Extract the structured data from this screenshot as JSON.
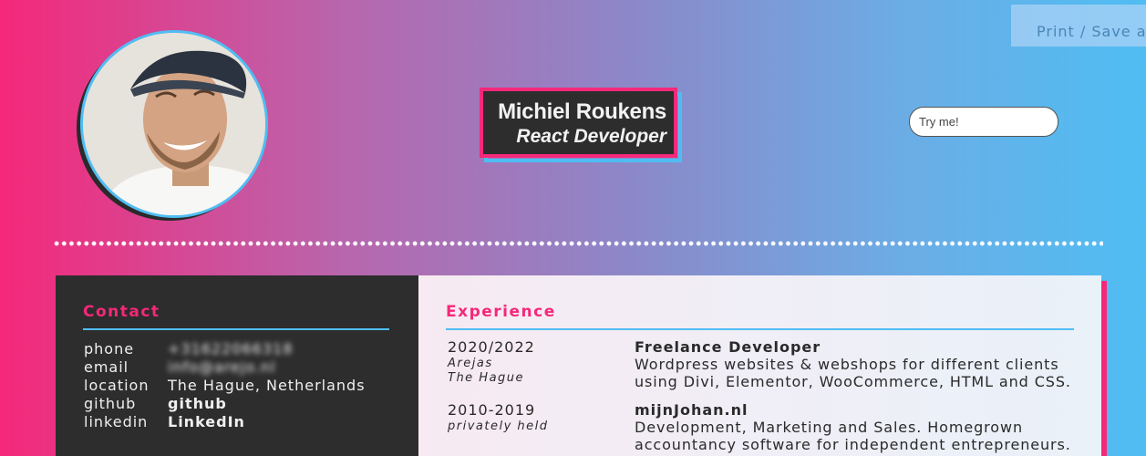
{
  "print_button": {
    "label": "Print / Save as PDF"
  },
  "profile": {
    "name": "Michiel Roukens",
    "role": "React Developer",
    "photo_alt": "profile photo"
  },
  "try_input": {
    "placeholder": "Try me!"
  },
  "contact": {
    "title": "Contact",
    "rows": [
      {
        "label": "phone",
        "value": "+31622066318"
      },
      {
        "label": "email",
        "value": "info@arejo.nl"
      },
      {
        "label": "location",
        "value": "The Hague, Netherlands"
      },
      {
        "label": "github",
        "value": "github"
      },
      {
        "label": "linkedin",
        "value": "LinkedIn"
      }
    ]
  },
  "experience": {
    "title": "Experience",
    "items": [
      {
        "period": "2020/2022",
        "company": "Arejas",
        "place": "The Hague",
        "title": "Freelance Developer",
        "description": "Wordpress websites & webshops for different clients using Divi, Elementor, WooCommerce, HTML and CSS."
      },
      {
        "period": "2010-2019",
        "company": "privately held",
        "title": "mijnJohan.nl",
        "description": "Development, Marketing and Sales. Homegrown accountancy software for independent entrepreneurs."
      }
    ]
  },
  "colors": {
    "accent_pink": "#f5287a",
    "accent_blue": "#4fbdf3",
    "panel_dark": "#2d2d2d"
  }
}
